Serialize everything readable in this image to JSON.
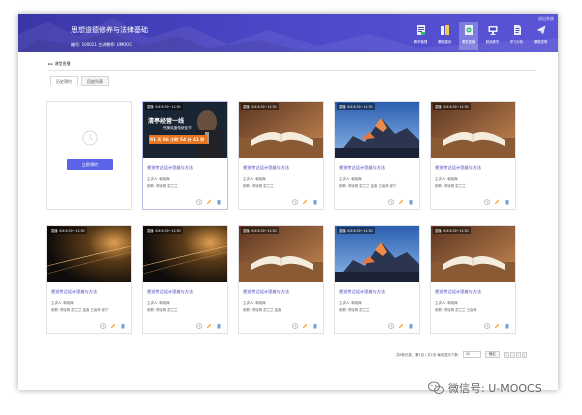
{
  "header": {
    "course_title": "思想道德修养与法律基础",
    "course_meta": "编号: 100011   主讲教师: UMOOC",
    "exit_link": "退出系统",
    "nav": [
      {
        "label": "教学管理",
        "icon": "teaching-management-icon"
      },
      {
        "label": "课程建设",
        "icon": "course-building-icon"
      },
      {
        "label": "课堂直播",
        "icon": "live-class-icon",
        "active": true
      },
      {
        "label": "精品教学",
        "icon": "featured-teaching-icon"
      },
      {
        "label": "学习分析",
        "icon": "learning-analysis-icon"
      },
      {
        "label": "课程说明",
        "icon": "course-info-icon"
      }
    ]
  },
  "breadcrumb": "课堂直播",
  "tabs": [
    "历史预约",
    "回放列表"
  ],
  "reserve_button": "立即预约",
  "live_overlay": {
    "line1": "清亭经营一线",
    "line2": "完美欢度传统佳节",
    "countdown": "01 天 06 小时 54 分 41 秒"
  },
  "cards": [
    {
      "time": "直播: 8.8 8:30~11:30",
      "title": "视觉传达设计思维与方法",
      "owner": "主讲人: 韩晓梅",
      "members": "助教: 李晓明    蒙兰兰",
      "image": "live"
    },
    {
      "time": "直播: 8.8 8:30~11:30",
      "title": "视觉传达设计思维与方法",
      "owner": "主讲人: 韩晓梅",
      "members": "助教: 李晓明    蒙兰兰",
      "image": "book"
    },
    {
      "time": "直播: 8.8 8:30~11:30",
      "title": "视觉传达设计思维与方法",
      "owner": "主讲人: 韩晓梅",
      "members": "助教: 李晓明    蒙兰兰    金鑫    王喜林    徐宁",
      "image": "mountain"
    },
    {
      "time": "直播: 8.8 8:30~11:30",
      "title": "视觉传达设计思维与方法",
      "owner": "主讲人: 韩晓梅",
      "members": "助教: 李晓明    蒙兰兰",
      "image": "book"
    },
    {
      "time": "直播: 8.8 8:30~11:30",
      "title": "视觉传达设计思维与方法",
      "owner": "主讲人: 韩晓梅",
      "members": "助教: 李晓明    蒙兰兰    金鑫    王喜林    徐宁",
      "image": "dark"
    },
    {
      "time": "直播: 8.8 8:30~11:30",
      "title": "视觉传达设计思维与方法",
      "owner": "主讲人: 韩晓梅",
      "members": "助教: 李晓明    蒙兰兰",
      "image": "dark"
    },
    {
      "time": "直播: 8.8 8:30~11:30",
      "title": "视觉传达设计思维与方法",
      "owner": "主讲人: 韩晓梅",
      "members": "助教: 李晓明    蒙兰兰    金鑫",
      "image": "book"
    },
    {
      "time": "直播: 8.8 8:30~11:30",
      "title": "视觉传达设计思维与方法",
      "owner": "主讲人: 韩晓梅",
      "members": "助教: 李晓明    蒙兰兰",
      "image": "mountain"
    },
    {
      "time": "直播: 8.8 8:30~11:30",
      "title": "视觉传达设计思维与方法",
      "owner": "主讲人: 韩晓梅",
      "members": "助教: 李晓明    蒙兰兰    王喜林",
      "image": "book"
    }
  ],
  "pager": {
    "summary": "共8条记录，第1页 / 共1页  每页显示个数:",
    "page_size": "30",
    "go": "确定"
  },
  "watermark": "微信号: U-MOOCS",
  "colors": {
    "header": "#4a46c6",
    "accent": "#5b63e6",
    "title_text": "#3a3ab0"
  }
}
